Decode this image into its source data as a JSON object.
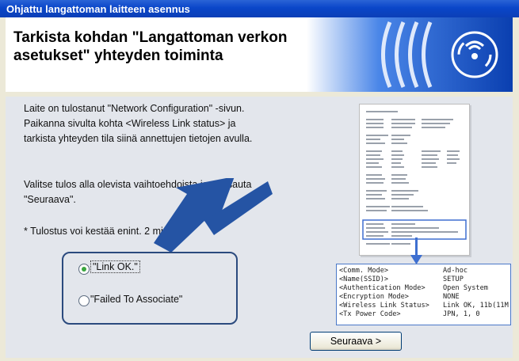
{
  "window": {
    "title": "Ohjattu langattoman laitteen asennus"
  },
  "header": {
    "title": "Tarkista kohdan \"Langattoman verkon asetukset\" yhteyden toiminta"
  },
  "instructions": {
    "line1": "Laite on tulostanut \"Network Configuration\" -sivun.",
    "line2": "Paikanna sivulta kohta <Wireless Link status> ja",
    "line3": "tarkista yhteyden tila siinä annettujen tietojen avulla.",
    "select_line1": "Valitse tulos alla olevista vaihtoehdoista ja napsauta",
    "select_line2": "\"Seuraava\".",
    "note": "* Tulostus voi kestää enint. 2 min."
  },
  "options": [
    {
      "label": "\"Link OK.\"",
      "selected": true
    },
    {
      "label": "\"Failed To Associate\"",
      "selected": false
    }
  ],
  "next_button": {
    "label": "Seuraava >"
  },
  "config_detail": {
    "rows": [
      {
        "key": "<Comm. Mode>",
        "value": "Ad-hoc"
      },
      {
        "key": "<Name(SSID)>",
        "value": "SETUP"
      },
      {
        "key": "<Authentication Mode>",
        "value": "Open System"
      },
      {
        "key": "<Encryption Mode>",
        "value": "NONE"
      },
      {
        "key": "<Wireless Link Status>",
        "value": "Link OK, 11b(11M"
      },
      {
        "key": "<Tx Power Code>",
        "value": "JPN, 1, 0"
      }
    ]
  },
  "colors": {
    "titlebar": "#0a46c9",
    "accent_blue": "#2d5aa8",
    "selected_radio": "#3aa640",
    "body_bg": "#e3e6ec"
  }
}
